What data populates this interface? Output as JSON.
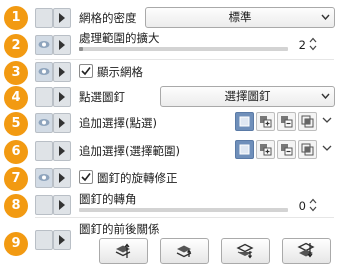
{
  "rows": [
    {
      "num": "1",
      "label": "網格的密度",
      "dropdown_value": "標準"
    },
    {
      "num": "2",
      "label": "處理範圍的擴大",
      "value": "2",
      "slider_level": 0.02
    },
    {
      "num": "3",
      "checkbox_label": "顯示網格",
      "checked": true
    },
    {
      "num": "4",
      "label": "點選圖釘",
      "dropdown_value": "選擇圖釘"
    },
    {
      "num": "5",
      "label": "追加選擇(點選)"
    },
    {
      "num": "6",
      "label": "追加選擇(選擇範圍)"
    },
    {
      "num": "7",
      "checkbox_label": "圖釘的旋轉修正",
      "checked": true
    },
    {
      "num": "8",
      "label": "圖釘的轉角",
      "value": "0",
      "slider_level": 0.0
    },
    {
      "num": "9",
      "label": "圖釘的前後關係"
    }
  ],
  "icons": {
    "eye": "eye-icon",
    "expand": "expand-arrow-icon",
    "new_selection": "new-selection-icon",
    "add_selection": "add-selection-icon",
    "subtract_selection": "subtract-selection-icon",
    "intersect_selection": "intersect-selection-icon",
    "bring_front": "bring-to-front-icon",
    "bring_forward": "bring-forward-icon",
    "send_backward": "send-backward-icon",
    "send_back": "send-to-back-icon"
  },
  "colors": {
    "badge": "#f29a12",
    "selected_mode": "#6f8fba"
  }
}
